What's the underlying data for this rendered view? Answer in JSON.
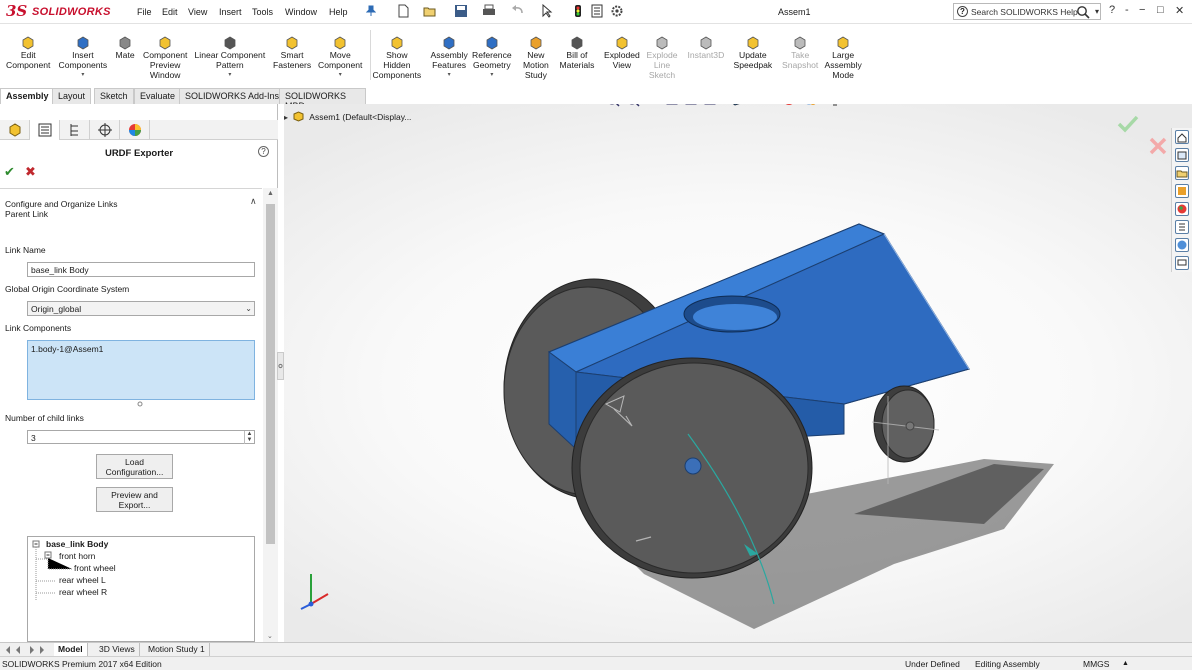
{
  "app": {
    "logo_mark": "3S",
    "logo_text": "SOLIDWORKS",
    "document_title": "Assem1",
    "menus": [
      "File",
      "Edit",
      "View",
      "Insert",
      "Tools",
      "Window",
      "Help"
    ],
    "help_search_placeholder": "Search SOLIDWORKS Help",
    "window_controls": [
      "?",
      "-",
      "−",
      "□",
      "✕"
    ]
  },
  "command_manager": {
    "commands": [
      {
        "label": "Edit\nComponent",
        "icon": "edit-component-icon",
        "enabled": true,
        "dropdown": false
      },
      {
        "label": "Insert\nComponents",
        "icon": "insert-components-icon",
        "enabled": true,
        "dropdown": true
      },
      {
        "label": "Mate",
        "icon": "mate-icon",
        "enabled": true,
        "dropdown": false
      },
      {
        "label": "Component\nPreview\nWindow",
        "icon": "component-preview-icon",
        "enabled": true,
        "dropdown": false
      },
      {
        "label": "Linear Component\nPattern",
        "icon": "linear-pattern-icon",
        "enabled": true,
        "dropdown": true
      },
      {
        "label": "Smart\nFasteners",
        "icon": "smart-fasteners-icon",
        "enabled": true,
        "dropdown": false
      },
      {
        "label": "Move\nComponent",
        "icon": "move-component-icon",
        "enabled": true,
        "dropdown": true
      },
      {
        "label": "Show\nHidden\nComponents",
        "icon": "show-hidden-icon",
        "enabled": true,
        "dropdown": false
      },
      {
        "label": "Assembly\nFeatures",
        "icon": "assembly-features-icon",
        "enabled": true,
        "dropdown": true
      },
      {
        "label": "Reference\nGeometry",
        "icon": "reference-geometry-icon",
        "enabled": true,
        "dropdown": true
      },
      {
        "label": "New\nMotion\nStudy",
        "icon": "motion-study-icon",
        "enabled": true,
        "dropdown": false
      },
      {
        "label": "Bill of\nMaterials",
        "icon": "bill-of-materials-icon",
        "enabled": true,
        "dropdown": false
      },
      {
        "label": "Exploded\nView",
        "icon": "exploded-view-icon",
        "enabled": true,
        "dropdown": false
      },
      {
        "label": "Explode\nLine\nSketch",
        "icon": "explode-line-icon",
        "enabled": false,
        "dropdown": false
      },
      {
        "label": "Instant3D",
        "icon": "instant3d-icon",
        "enabled": false,
        "dropdown": false
      },
      {
        "label": "Update\nSpeedpak",
        "icon": "speedpak-icon",
        "enabled": true,
        "dropdown": false
      },
      {
        "label": "Take\nSnapshot",
        "icon": "snapshot-icon",
        "enabled": false,
        "dropdown": false
      },
      {
        "label": "Large\nAssembly\nMode",
        "icon": "large-assembly-icon",
        "enabled": true,
        "dropdown": false
      }
    ],
    "tabs": [
      "Assembly",
      "Layout",
      "Sketch",
      "Evaluate",
      "SOLIDWORKS Add-Ins",
      "SOLIDWORKS MBD"
    ],
    "active_tab": "Assembly"
  },
  "property_manager": {
    "title": "URDF Exporter",
    "help": "?",
    "ok": "✔",
    "cancel": "✖",
    "group_title": "Configure and Organize Links",
    "collapse": "∧",
    "parent_link_label": "Parent Link",
    "link_name_label": "Link Name",
    "link_name_value": "base_link Body",
    "origin_label": "Global Origin Coordinate System",
    "origin_value": "Origin_global",
    "link_components_label": "Link Components",
    "link_components_items": [
      "1.body-1@Assem1"
    ],
    "child_links_label": "Number of child links",
    "child_links_value": "3",
    "load_button": "Load\nConfiguration...",
    "preview_button": "Preview and\nExport...",
    "tree": {
      "root": "base_link Body",
      "children": [
        {
          "label": "front horn",
          "children": [
            {
              "label": "front wheel"
            }
          ]
        },
        {
          "label": "rear wheel L"
        },
        {
          "label": "rear wheel R"
        }
      ]
    }
  },
  "viewport": {
    "feature_tree_item": "Assem1  (Default<Display..."
  },
  "bottom_tabs": [
    "Model",
    "3D Views",
    "Motion Study 1"
  ],
  "active_bottom_tab": "Model",
  "status_bar": {
    "edition": "SOLIDWORKS Premium 2017 x64 Edition",
    "state": "Under Defined",
    "mode": "Editing Assembly",
    "units": "MMGS"
  },
  "colors": {
    "body_blue": "#2f6fc4",
    "wheel_gray": "#555555",
    "brand_red": "#c8102e",
    "selection_blue": "#cce4f7"
  }
}
